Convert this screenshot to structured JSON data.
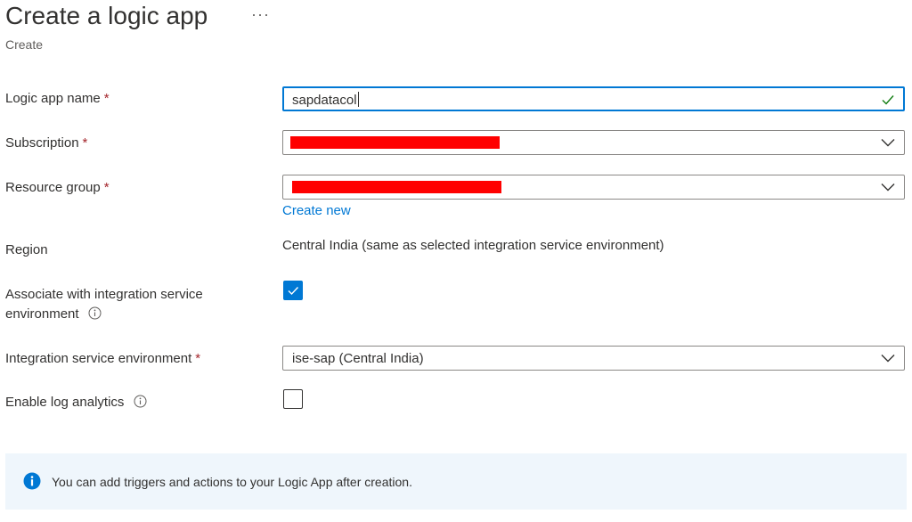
{
  "header": {
    "title": "Create a logic app",
    "more_label": "···",
    "subtitle": "Create"
  },
  "form": {
    "required_marker": "*",
    "name": {
      "label": "Logic app name",
      "value": "sapdatacol"
    },
    "subscription": {
      "label": "Subscription",
      "value": ""
    },
    "resource_group": {
      "label": "Resource group",
      "value": "",
      "create_new": "Create new"
    },
    "region": {
      "label": "Region",
      "value": "Central India (same as selected integration service environment)"
    },
    "associate_ise": {
      "label_line1": "Associate with integration service",
      "label_line2": "environment",
      "checked": true
    },
    "ise": {
      "label": "Integration service environment",
      "value": "ise-sap (Central India)"
    },
    "log_analytics": {
      "label": "Enable log analytics",
      "checked": false
    }
  },
  "banner": {
    "message": "You can add triggers and actions to your Logic App after creation."
  },
  "colors": {
    "accent": "#0078d4",
    "required": "#a4262c",
    "redaction": "#ff0000",
    "valid": "#107c10",
    "banner_bg": "#eff6fc"
  },
  "icons": [
    "more-icon",
    "valid-check-icon",
    "chevron-down-icon",
    "info-icon",
    "checkbox-check-icon"
  ]
}
